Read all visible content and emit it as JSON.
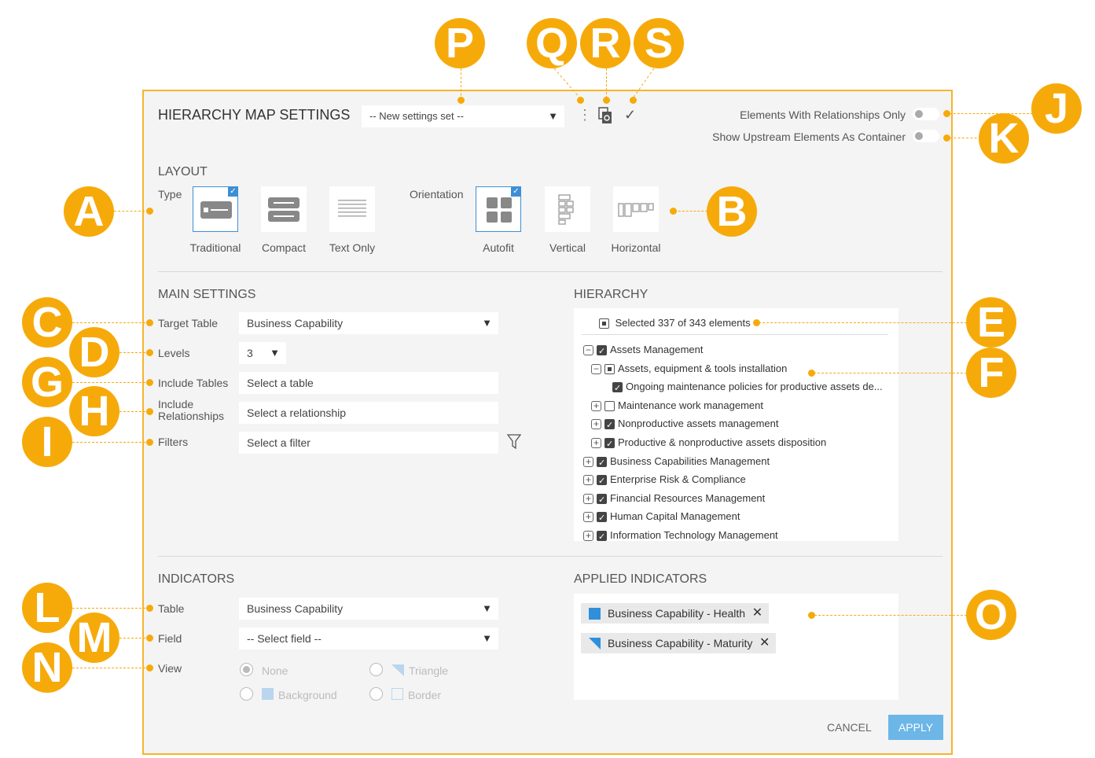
{
  "dialog": {
    "title": "HIERARCHY MAP SETTINGS",
    "settings_select": "-- New settings set --",
    "toggles": [
      {
        "label": "Elements With Relationships Only"
      },
      {
        "label": "Show Upstream Elements As Container"
      }
    ]
  },
  "layout": {
    "heading": "LAYOUT",
    "type_label": "Type",
    "types": [
      {
        "label": "Traditional",
        "selected": true
      },
      {
        "label": "Compact",
        "selected": false
      },
      {
        "label": "Text Only",
        "selected": false
      }
    ],
    "orientation_label": "Orientation",
    "orientations": [
      {
        "label": "Autofit",
        "selected": true
      },
      {
        "label": "Vertical",
        "selected": false
      },
      {
        "label": "Horizontal",
        "selected": false
      }
    ]
  },
  "main_settings": {
    "heading": "MAIN SETTINGS",
    "target_table_label": "Target Table",
    "target_table_value": "Business Capability",
    "levels_label": "Levels",
    "levels_value": "3",
    "include_tables_label": "Include Tables",
    "include_tables_placeholder": "Select a table",
    "include_rel_label_1": "Include",
    "include_rel_label_2": "Relationships",
    "include_rel_placeholder": "Select a relationship",
    "filters_label": "Filters",
    "filters_placeholder": "Select a filter"
  },
  "hierarchy": {
    "heading": "HIERARCHY",
    "summary": "Selected 337 of 343 elements",
    "items": [
      {
        "label": "Assets Management",
        "toggle": "−",
        "check": "checked",
        "level": 0
      },
      {
        "label": "Assets, equipment & tools installation",
        "toggle": "−",
        "check": "partial",
        "level": 1
      },
      {
        "label": "Ongoing maintenance policies for productive assets de...",
        "toggle": "",
        "check": "checked",
        "level": 2
      },
      {
        "label": "Maintenance work management",
        "toggle": "+",
        "check": "none",
        "level": 1
      },
      {
        "label": "Nonproductive assets management",
        "toggle": "+",
        "check": "checked",
        "level": 1
      },
      {
        "label": "Productive & nonproductive assets disposition",
        "toggle": "+",
        "check": "checked",
        "level": 1
      },
      {
        "label": "Business Capabilities Management",
        "toggle": "+",
        "check": "checked",
        "level": 0
      },
      {
        "label": "Enterprise Risk & Compliance",
        "toggle": "+",
        "check": "checked",
        "level": 0
      },
      {
        "label": "Financial Resources Management",
        "toggle": "+",
        "check": "checked",
        "level": 0
      },
      {
        "label": "Human Capital Management",
        "toggle": "+",
        "check": "checked",
        "level": 0
      },
      {
        "label": "Information Technology Management",
        "toggle": "+",
        "check": "checked",
        "level": 0
      }
    ]
  },
  "indicators": {
    "heading": "INDICATORS",
    "table_label": "Table",
    "table_value": "Business Capability",
    "field_label": "Field",
    "field_value": "-- Select field --",
    "view_label": "View",
    "view_options": [
      {
        "label": "None"
      },
      {
        "label": "Triangle"
      },
      {
        "label": "Background"
      },
      {
        "label": "Border"
      }
    ]
  },
  "applied_indicators": {
    "heading": "APPLIED INDICATORS",
    "chips": [
      {
        "label": "Business Capability - Health"
      },
      {
        "label": "Business Capability - Maturity"
      }
    ]
  },
  "footer": {
    "cancel": "CANCEL",
    "apply": "APPLY"
  },
  "callouts": {
    "A": "A",
    "B": "B",
    "C": "C",
    "D": "D",
    "E": "E",
    "F": "F",
    "G": "G",
    "H": "H",
    "I": "I",
    "J": "J",
    "K": "K",
    "L": "L",
    "M": "M",
    "N": "N",
    "O": "O",
    "P": "P",
    "Q": "Q",
    "R": "R",
    "S": "S"
  },
  "colors": {
    "accent": "#f6aa0a",
    "selection_blue": "#3d8fd6",
    "apply_button": "#6cb6e8",
    "indicator_health": "#2f8fdb",
    "indicator_maturity": "#2f8fdb"
  }
}
